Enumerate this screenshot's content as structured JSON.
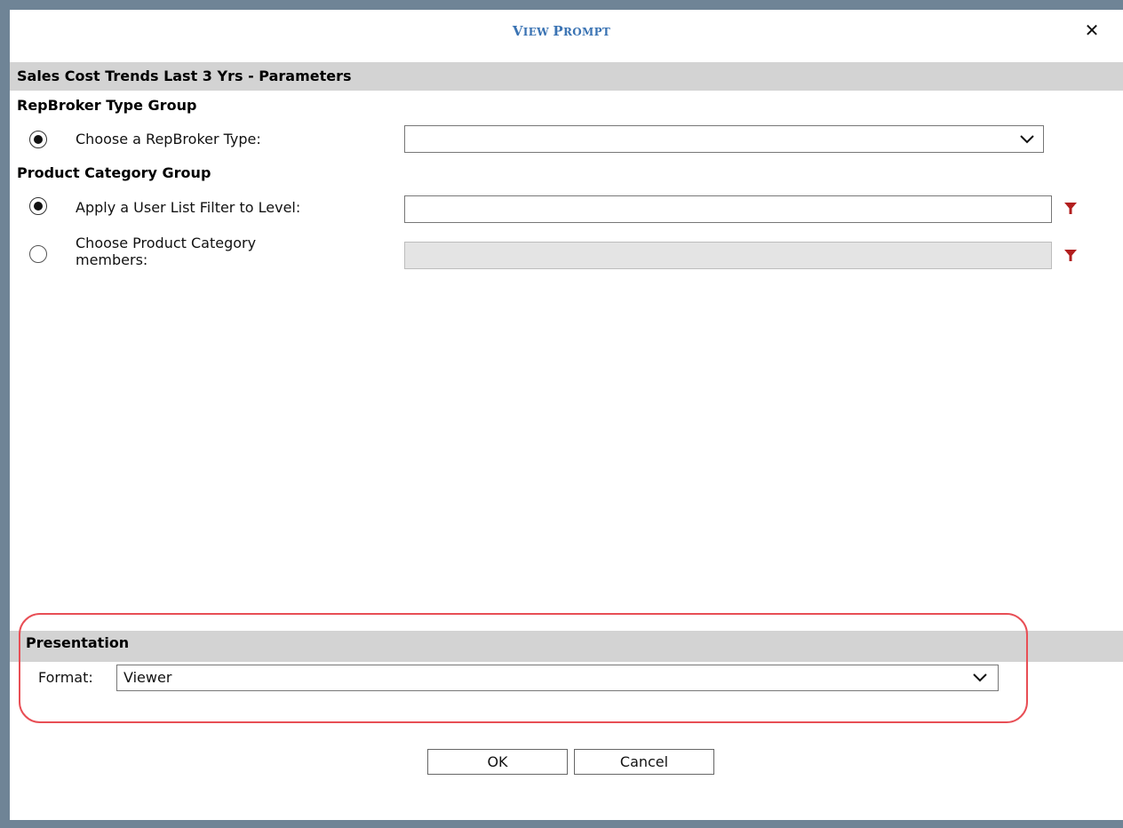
{
  "dialog": {
    "title_first": "V",
    "title_rest": "IEW ",
    "title_first2": "P",
    "title_rest2": "ROMPT",
    "close_label": "✕"
  },
  "parameters": {
    "header": "Sales Cost Trends Last 3 Yrs - Parameters",
    "groups": [
      {
        "title": "RepBroker Type Group",
        "options": [
          {
            "label": "Choose a RepBroker Type:",
            "selected": true,
            "control": "dropdown",
            "value": ""
          }
        ]
      },
      {
        "title": "Product Category Group",
        "options": [
          {
            "label": "Apply a User List Filter to Level:",
            "selected": true,
            "control": "text-with-filter",
            "value": ""
          },
          {
            "label_line1": "Choose Product Category",
            "label_line2": "members:",
            "selected": false,
            "control": "text-with-filter",
            "disabled": true,
            "value": ""
          }
        ]
      }
    ]
  },
  "presentation": {
    "header": "Presentation",
    "format_label": "Format:",
    "format_value": "Viewer"
  },
  "buttons": {
    "ok": "OK",
    "cancel": "Cancel"
  },
  "colors": {
    "title": "#3a73b3",
    "filter_icon": "#b21e1e",
    "highlight": "#e84e55",
    "section_bar": "#d3d3d3",
    "backdrop": "#6f8496"
  },
  "icons": {
    "close": "close-icon",
    "dropdown": "chevron-down-icon",
    "filter": "filter-icon"
  }
}
